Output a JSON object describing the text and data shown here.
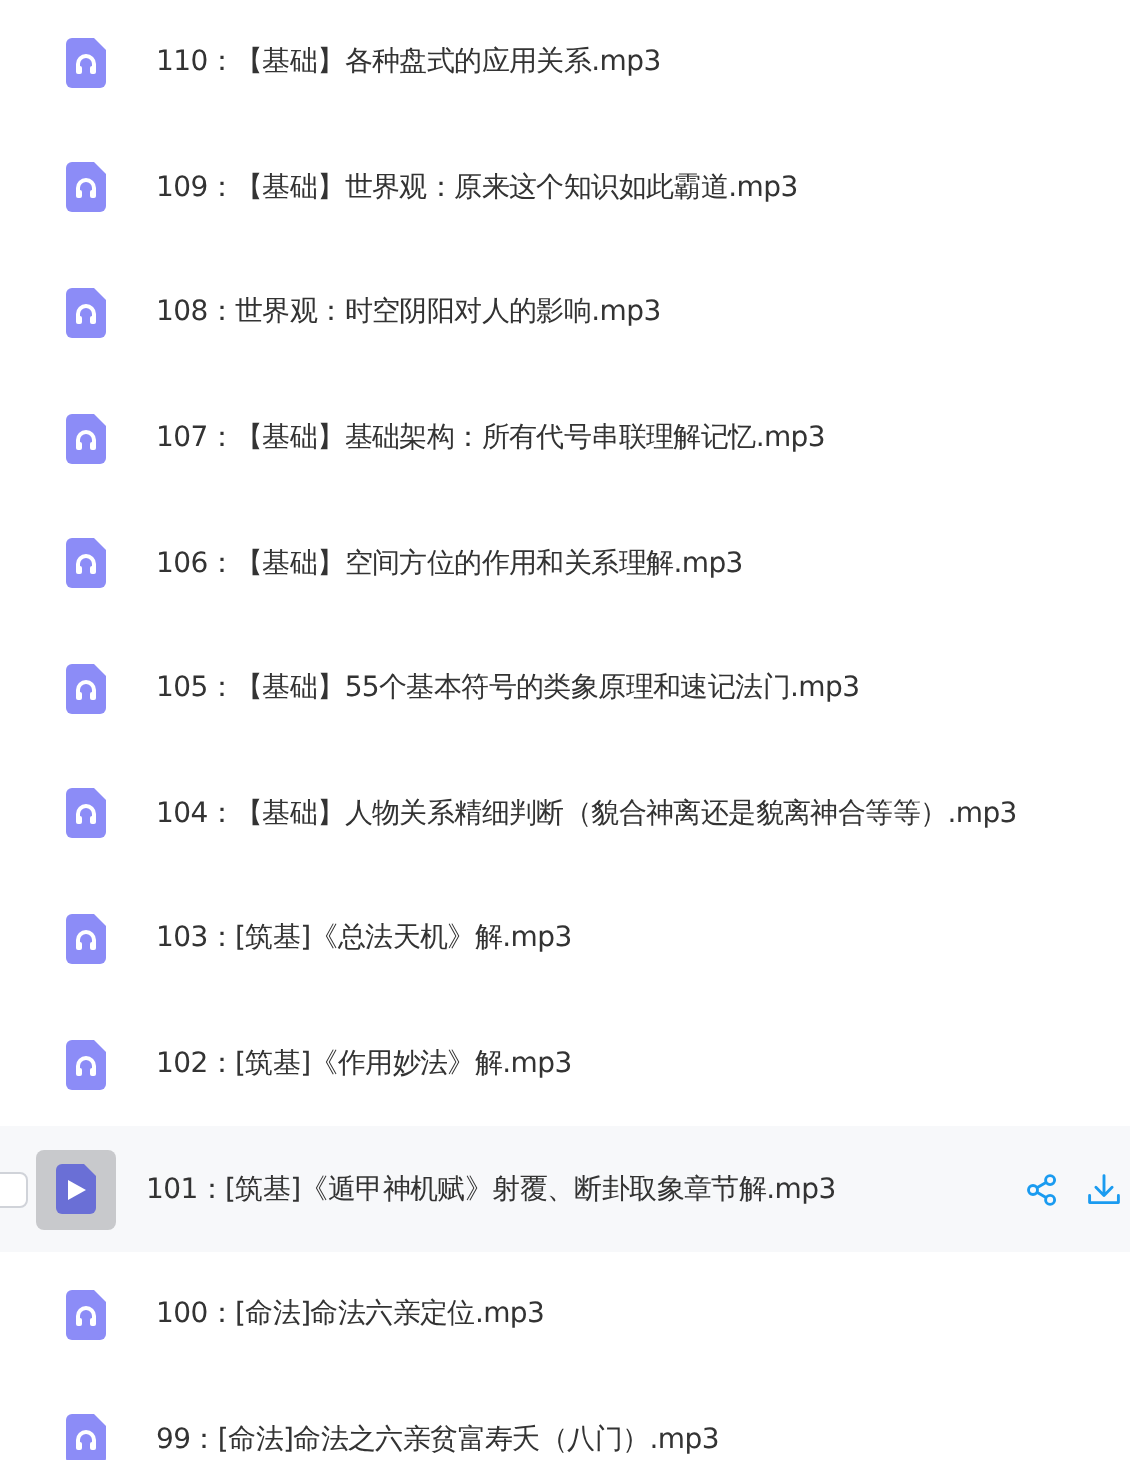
{
  "files": [
    {
      "name": "110：【基础】各种盘式的应用关系.mp3",
      "hovered": false
    },
    {
      "name": "109：【基础】世界观：原来这个知识如此霸道.mp3",
      "hovered": false
    },
    {
      "name": "108：世界观：时空阴阳对人的影响.mp3",
      "hovered": false
    },
    {
      "name": "107：【基础】基础架构：所有代号串联理解记忆.mp3",
      "hovered": false
    },
    {
      "name": "106：【基础】空间方位的作用和关系理解.mp3",
      "hovered": false
    },
    {
      "name": "105：【基础】55个基本符号的类象原理和速记法门.mp3",
      "hovered": false
    },
    {
      "name": "104：【基础】人物关系精细判断（貌合神离还是貌离神合等等）.mp3",
      "hovered": false
    },
    {
      "name": "103：[筑基]《总法天机》解.mp3",
      "hovered": false
    },
    {
      "name": "102：[筑基]《作用妙法》解.mp3",
      "hovered": false
    },
    {
      "name": "101：[筑基]《遁甲神机赋》射覆、断卦取象章节解.mp3",
      "hovered": true
    },
    {
      "name": "100：[命法]命法六亲定位.mp3",
      "hovered": false
    },
    {
      "name": "99：[命法]命法之六亲贫富寿夭（八门）.mp3",
      "hovered": false
    }
  ]
}
